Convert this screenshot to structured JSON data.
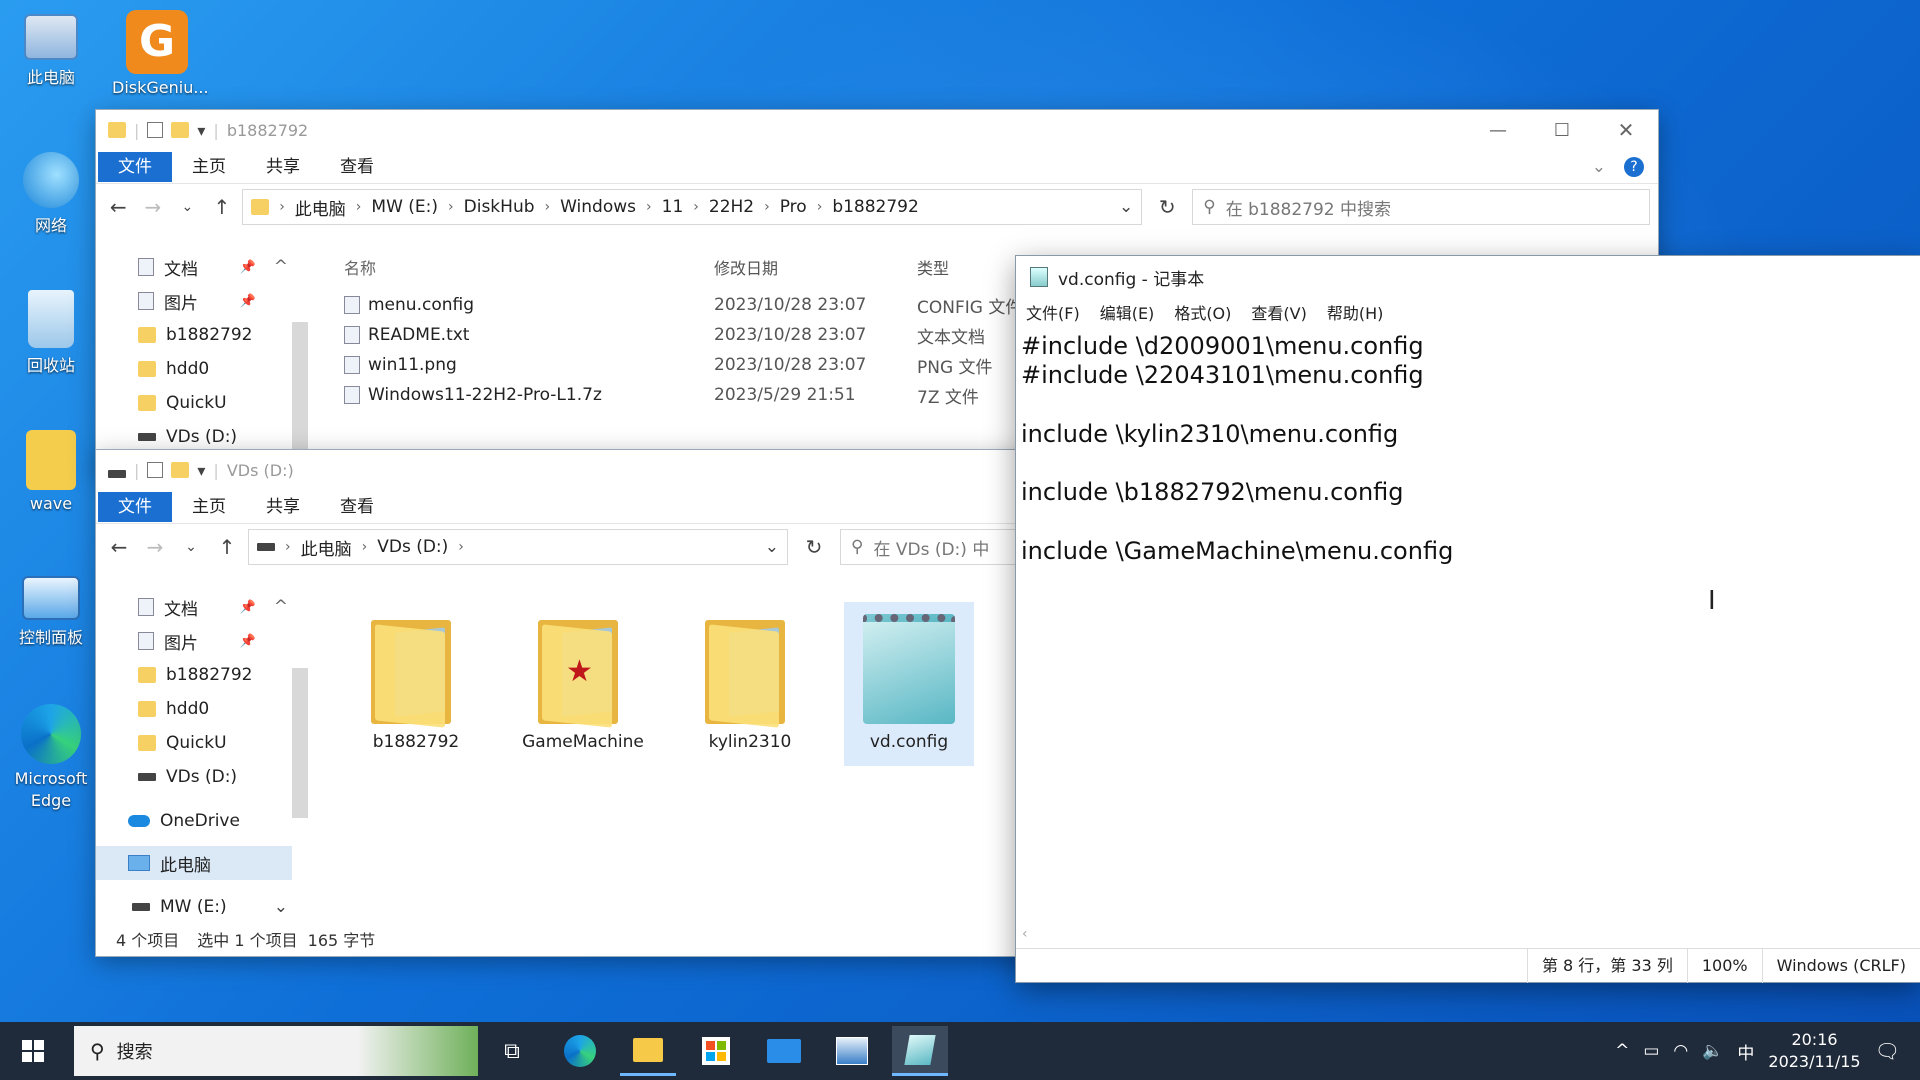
{
  "desktop": {
    "icons": [
      {
        "label": "此电脑",
        "icon": "computer-icon"
      },
      {
        "label": "DiskGeniu...",
        "icon": "diskgenius-icon"
      },
      {
        "label": "网络",
        "icon": "network-icon"
      },
      {
        "label": "回收站",
        "icon": "recycle-bin-icon"
      },
      {
        "label": "wave",
        "icon": "user-folder-icon"
      },
      {
        "label": "控制面板",
        "icon": "control-panel-icon"
      },
      {
        "label": "Microsoft Edge",
        "icon": "edge-icon"
      }
    ]
  },
  "explorer1": {
    "title": "b1882792",
    "ribbon": {
      "file": "文件",
      "home": "主页",
      "share": "共享",
      "view": "查看"
    },
    "crumbs": [
      "此电脑",
      "MW (E:)",
      "DiskHub",
      "Windows",
      "11",
      "22H2",
      "Pro",
      "b1882792"
    ],
    "search_placeholder": "在 b1882792 中搜索",
    "sidebar": [
      "文档",
      "图片",
      "b1882792",
      "hdd0",
      "QuickU",
      "VDs (D:)"
    ],
    "columns": {
      "name": "名称",
      "date": "修改日期",
      "type": "类型"
    },
    "files": [
      {
        "name": "menu.config",
        "date": "2023/10/28 23:07",
        "type": "CONFIG 文件"
      },
      {
        "name": "README.txt",
        "date": "2023/10/28 23:07",
        "type": "文本文档"
      },
      {
        "name": "win11.png",
        "date": "2023/10/28 23:07",
        "type": "PNG 文件"
      },
      {
        "name": "Windows11-22H2-Pro-L1.7z",
        "date": "2023/5/29 21:51",
        "type": "7Z 文件"
      }
    ]
  },
  "explorer2": {
    "title": "VDs (D:)",
    "ribbon": {
      "file": "文件",
      "home": "主页",
      "share": "共享",
      "view": "查看"
    },
    "crumbs": [
      "此电脑",
      "VDs (D:)"
    ],
    "search_placeholder": "在 VDs (D:) 中",
    "sidebar": [
      "文档",
      "图片",
      "b1882792",
      "hdd0",
      "QuickU",
      "VDs (D:)",
      "OneDrive",
      "此电脑",
      "MW (E:)"
    ],
    "items": [
      "b1882792",
      "GameMachine",
      "kylin2310",
      "vd.config"
    ],
    "status": {
      "count": "4 个项目",
      "selected": "选中 1 个项目",
      "size": "165 字节"
    }
  },
  "notepad": {
    "title": "vd.config - 记事本",
    "menu": [
      "文件(F)",
      "编辑(E)",
      "格式(O)",
      "查看(V)",
      "帮助(H)"
    ],
    "lines": [
      "#include \\d2009001\\menu.config",
      "#include \\22043101\\menu.config",
      "",
      "include \\kylin2310\\menu.config",
      "",
      "include \\b1882792\\menu.config",
      "",
      "include \\GameMachine\\menu.config"
    ],
    "status": {
      "position": "第 8 行，第 33 列",
      "zoom": "100%",
      "eol": "Windows (CRLF)"
    }
  },
  "taskbar": {
    "search": "搜索",
    "ime": "中",
    "time": "20:16",
    "date": "2023/11/15"
  }
}
